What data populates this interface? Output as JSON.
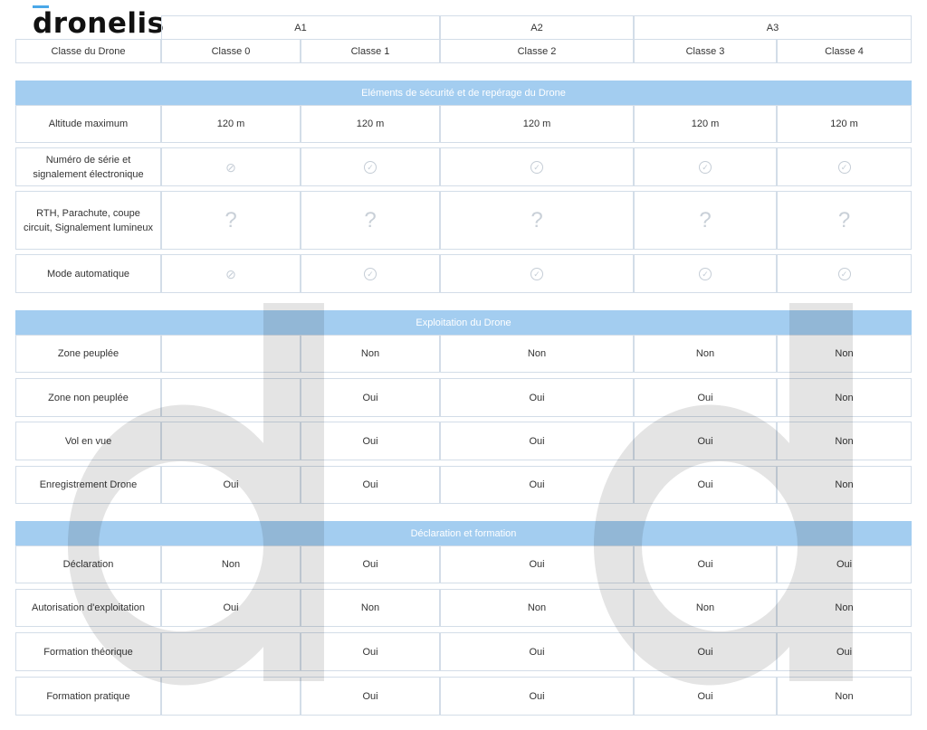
{
  "brand": {
    "logo": "dronelis",
    "accent": "#4aa8e8"
  },
  "header": {
    "groups": [
      "A1",
      "A2",
      "A3"
    ],
    "row_label": "Classe du Drone",
    "classes": [
      "Classe 0",
      "Classe 1",
      "Classe 2",
      "Classe 3",
      "Classe 4"
    ]
  },
  "sections": [
    {
      "title": "Eléments de sécurité et de repérage du Drone",
      "rows": [
        {
          "label": "Altitude maximum",
          "values": [
            "120 m",
            "120 m",
            "120 m",
            "120 m",
            "120 m"
          ]
        },
        {
          "label": "Numéro de série et signalement électronique",
          "icons": [
            "prohibited-icon",
            "check-circle-icon",
            "check-circle-icon",
            "check-circle-icon",
            "check-circle-icon"
          ]
        },
        {
          "label": "RTH, Parachute, coupe circuit, Signalement lumineux",
          "values": [
            "?",
            "?",
            "?",
            "?",
            "?"
          ]
        },
        {
          "label": "Mode automatique",
          "icons": [
            "prohibited-icon",
            "check-circle-icon",
            "check-circle-icon",
            "check-circle-icon",
            "check-circle-icon"
          ]
        }
      ]
    },
    {
      "title": "Exploitation du Drone",
      "rows": [
        {
          "label": "Zone peuplée",
          "values": [
            "",
            "Non",
            "Non",
            "Non",
            "Non"
          ]
        },
        {
          "label": "Zone non peuplée",
          "values": [
            "",
            "Oui",
            "Oui",
            "Oui",
            "Non"
          ]
        },
        {
          "label": "Vol en vue",
          "values": [
            "",
            "Oui",
            "Oui",
            "Oui",
            "Non"
          ]
        },
        {
          "label": "Enregistrement Drone",
          "values": [
            "Oui",
            "Oui",
            "Oui",
            "Oui",
            "Non"
          ]
        }
      ]
    },
    {
      "title": "Déclaration et formation",
      "rows": [
        {
          "label": "Déclaration",
          "values": [
            "Non",
            "Oui",
            "Oui",
            "Oui",
            "Oui"
          ]
        },
        {
          "label": "Autorisation d'exploitation",
          "values": [
            "Oui",
            "Non",
            "Non",
            "Non",
            "Non"
          ]
        },
        {
          "label": "Formation théorique",
          "values": [
            "",
            "Oui",
            "Oui",
            "Oui",
            "Oui"
          ]
        },
        {
          "label": "Formation pratique",
          "values": [
            "",
            "Oui",
            "Oui",
            "Oui",
            "Non"
          ]
        }
      ]
    }
  ],
  "colors": {
    "section_bar": "#a3cdf0",
    "border": "#d3dde8",
    "watermark": "#e6e6e6"
  }
}
